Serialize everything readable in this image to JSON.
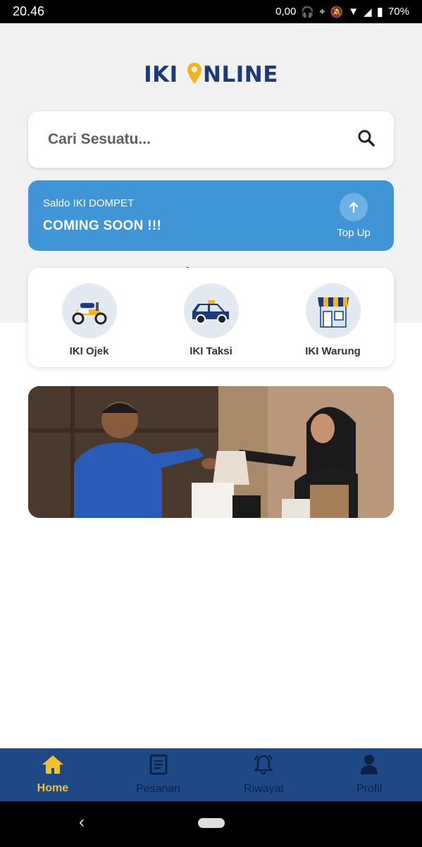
{
  "status_bar": {
    "time": "20.46",
    "network_speed": "0,00",
    "battery": "70%"
  },
  "logo": {
    "part1": "IKI ",
    "part2": "NLINE"
  },
  "search": {
    "placeholder": "Cari Sesuatu..."
  },
  "wallet": {
    "label": "Saldo IKI DOMPET",
    "value": "COMING SOON !!!",
    "topup_label": "Top Up"
  },
  "services": [
    {
      "label": "IKI Ojek",
      "icon": "motorcycle-icon"
    },
    {
      "label": "IKI Taksi",
      "icon": "car-icon"
    },
    {
      "label": "IKI Warung",
      "icon": "store-icon"
    }
  ],
  "bottom_nav": [
    {
      "label": "Home",
      "icon": "home-icon",
      "active": true
    },
    {
      "label": "Pesanan",
      "icon": "document-icon",
      "active": false
    },
    {
      "label": "Riwayat",
      "icon": "bell-icon",
      "active": false
    },
    {
      "label": "Profil",
      "icon": "user-icon",
      "active": false
    }
  ],
  "colors": {
    "brand_navy": "#1d3b78",
    "accent_yellow": "#f2c12e",
    "wallet_blue": "#3f95d6",
    "nav_bg": "#1f4986"
  }
}
